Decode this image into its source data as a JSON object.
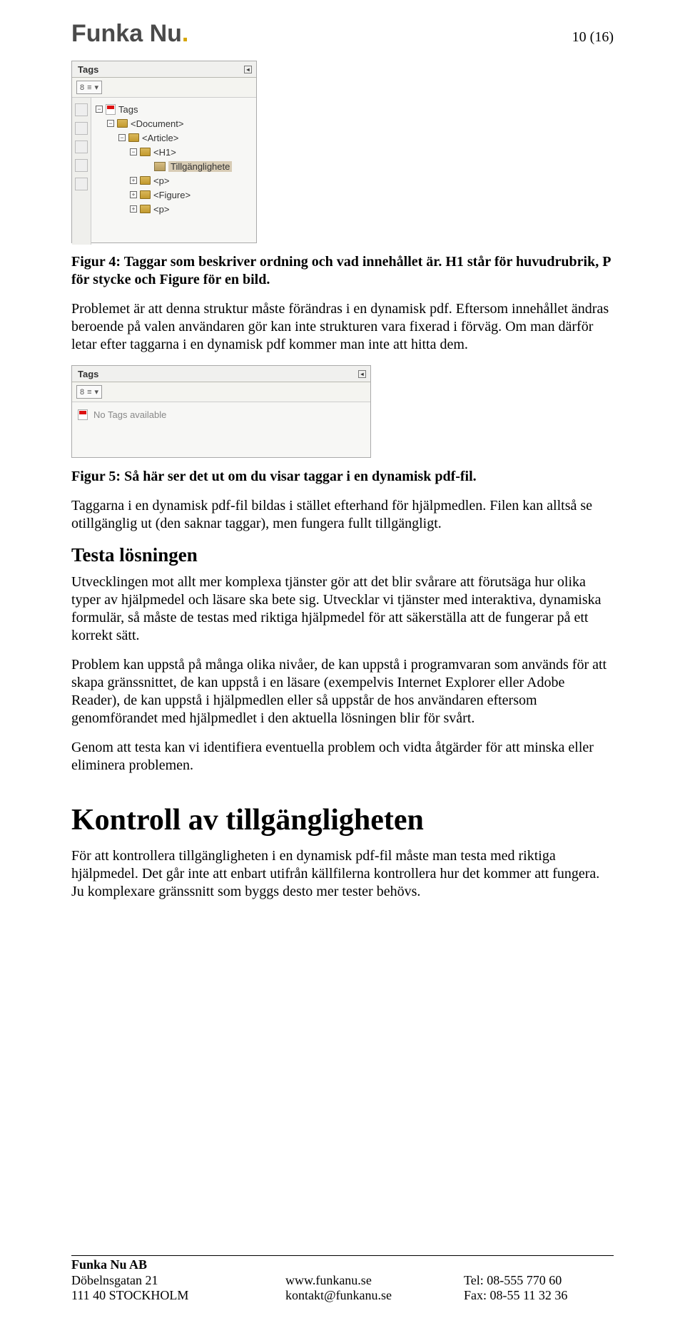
{
  "header": {
    "logo_text": "Funka Nu",
    "logo_dot": ".",
    "page_number": "10 (16)"
  },
  "screenshot1": {
    "title": "Tags",
    "dd_label": "8",
    "tree": {
      "root": "Tags",
      "n1": "<Document>",
      "n2": "<Article>",
      "n3": "<H1>",
      "n3a": "Tillgänglighete",
      "n4": "<p>",
      "n5": "<Figure>",
      "n6": "<p>"
    }
  },
  "caption4": "Figur 4: Taggar som beskriver ordning och vad innehållet är. H1 står för huvudrubrik, P för stycke och Figure för en bild.",
  "para1": "Problemet är att denna struktur måste förändras i en dynamisk pdf. Eftersom innehållet ändras beroende på valen användaren gör kan inte strukturen vara fixerad i förväg. Om man därför letar efter taggarna i en dynamisk pdf kommer man inte att hitta dem.",
  "screenshot2": {
    "title": "Tags",
    "dd_label": "8",
    "msg": "No Tags available"
  },
  "caption5": "Figur 5: Så här ser det ut om du visar taggar i en dynamisk pdf-fil.",
  "para2": "Taggarna i en dynamisk pdf-fil bildas i stället efterhand för hjälpmedlen. Filen kan alltså se otillgänglig ut (den saknar taggar), men fungera fullt tillgängligt.",
  "h3": "Testa lösningen",
  "para3": "Utvecklingen mot allt mer komplexa tjänster gör att det blir svårare att förutsäga hur olika typer av hjälpmedel och läsare ska bete sig. Utvecklar vi tjänster med interaktiva, dynamiska formulär, så måste de testas med riktiga hjälpmedel för att säkerställa att de fungerar på ett korrekt sätt.",
  "para4": "Problem kan uppstå på många olika nivåer, de kan uppstå i programvaran som används för att skapa gränssnittet, de kan uppstå i en läsare (exempelvis Internet Explorer eller Adobe Reader), de kan uppstå i hjälpmedlen eller så uppstår de hos användaren eftersom genomförandet med hjälpmedlet i den aktuella lösningen blir för svårt.",
  "para5": "Genom att testa kan vi identifiera eventuella problem och vidta åtgärder för att minska eller eliminera problemen.",
  "h1": "Kontroll av tillgängligheten",
  "para6": "För att kontrollera tillgängligheten i en dynamisk pdf-fil måste man testa med riktiga hjälpmedel. Det går inte att enbart utifrån källfilerna kontrollera hur det kommer att fungera. Ju komplexare gränssnitt som byggs desto mer tester behövs.",
  "footer": {
    "company": "Funka Nu AB",
    "addr1": "Döbelnsgatan 21",
    "addr2": "111 40 STOCKHOLM",
    "url": "www.funkanu.se",
    "email": "kontakt@funkanu.se",
    "tel": "Tel: 08-555 770 60",
    "fax": "Fax: 08-55 11 32 36"
  }
}
